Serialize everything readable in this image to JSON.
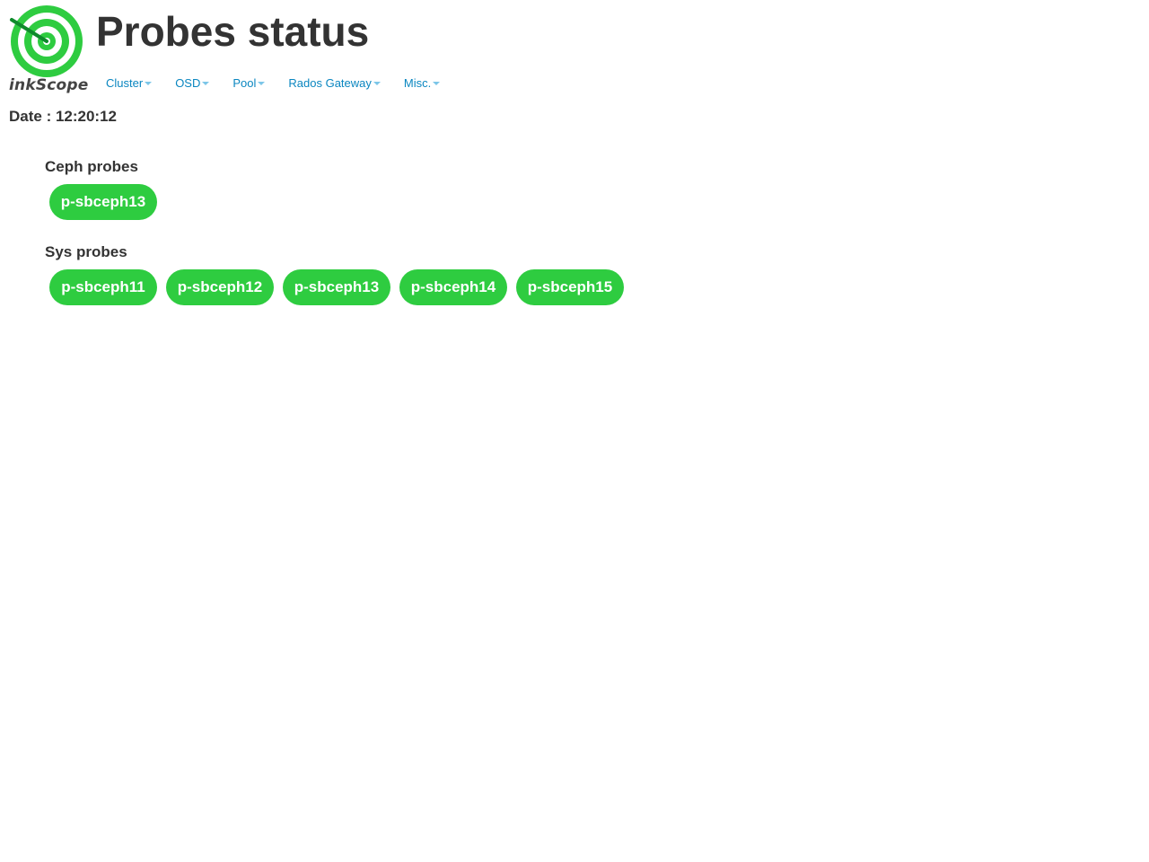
{
  "header": {
    "logo_text": "inkScope",
    "title": "Probes status"
  },
  "navbar": {
    "items": [
      {
        "label": "Cluster",
        "icon": "caret-down-icon"
      },
      {
        "label": "OSD",
        "icon": "caret-down-icon"
      },
      {
        "label": "Pool",
        "icon": "caret-down-icon"
      },
      {
        "label": "Rados Gateway",
        "icon": "caret-down-icon"
      },
      {
        "label": "Misc.",
        "icon": "caret-down-icon"
      }
    ]
  },
  "date": {
    "label": "Date : 12:20:12"
  },
  "ceph_probes": {
    "title": "Ceph probes",
    "items": [
      "p-sbceph13"
    ]
  },
  "sys_probes": {
    "title": "Sys probes",
    "items": [
      "p-sbceph11",
      "p-sbceph12",
      "p-sbceph13",
      "p-sbceph14",
      "p-sbceph15"
    ]
  },
  "colors": {
    "probe_ok": "#2ecc40",
    "nav_link": "#0a86c0",
    "logo_green": "#2ecc40",
    "logo_dark_green": "#0f8a2c"
  }
}
